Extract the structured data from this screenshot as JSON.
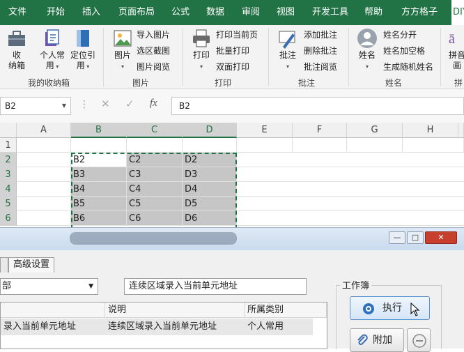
{
  "tabs": [
    "文件",
    "开始",
    "插入",
    "页面布局",
    "公式",
    "数据",
    "审阅",
    "视图",
    "开发工具",
    "帮助",
    "方方格子",
    "DIY"
  ],
  "ribbon": {
    "groups": [
      {
        "label": "我的收纳箱",
        "buttons": [
          "收\n纳箱",
          "个人常\n用",
          "定位引\n用"
        ]
      },
      {
        "label": "图片",
        "big": "图片",
        "small": [
          "导入图片",
          "选区截图",
          "图片阅览"
        ]
      },
      {
        "label": "打印",
        "big": "打印",
        "small": [
          "打印当前页",
          "批量打印",
          "双面打印"
        ]
      },
      {
        "label": "批注",
        "big": "批注",
        "small": [
          "添加批注",
          "删除批注",
          "批注阅览"
        ]
      },
      {
        "label": "姓名",
        "big": "姓名",
        "small": [
          "姓名分开",
          "姓名加空格",
          "生成随机姓名"
        ]
      },
      {
        "label": "拼",
        "big": "拼音\n画"
      }
    ]
  },
  "formula_bar": {
    "name_box": "B2",
    "formula": "B2"
  },
  "grid": {
    "columns": [
      "A",
      "B",
      "C",
      "D",
      "E",
      "F",
      "G",
      "H"
    ],
    "rows": [
      "1",
      "2",
      "3",
      "4",
      "5",
      "6"
    ],
    "cells": [
      [
        "B2",
        "C2",
        "D2"
      ],
      [
        "B3",
        "C3",
        "D3"
      ],
      [
        "B4",
        "C4",
        "D4"
      ],
      [
        "B5",
        "C5",
        "D5"
      ],
      [
        "B6",
        "C6",
        "D6"
      ]
    ]
  },
  "dialog": {
    "tab": "高级设置",
    "combo_value": "部",
    "description_value": "连续区域录入当前单元地址",
    "list_headers": [
      "",
      "说明",
      "所属类别"
    ],
    "list_row": [
      "录入当前单元地址",
      "连续区域录入当前单元地址",
      "个人常用"
    ],
    "workbook_label": "工作簿",
    "run_label": "执行",
    "attach_label": "附加"
  },
  "colors": {
    "excel_green": "#217346",
    "selection": "#c6c6c6"
  }
}
